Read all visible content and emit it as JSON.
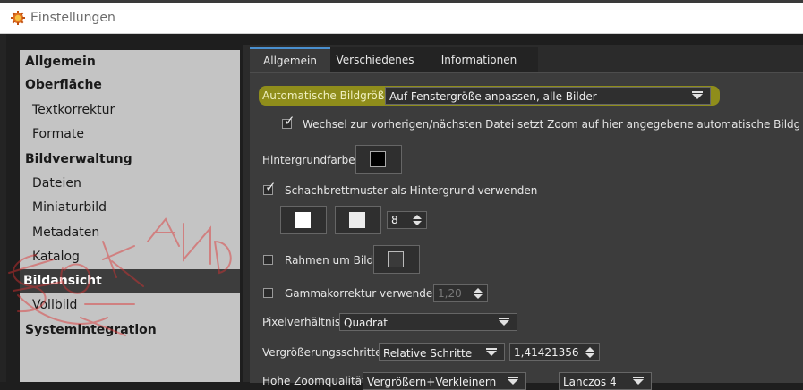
{
  "window": {
    "title": "Einstellungen",
    "app_icon": "gear-icon",
    "accent": "#e07020"
  },
  "sidebar": {
    "items": [
      {
        "label": "Allgemein",
        "bold": true
      },
      {
        "label": "Oberfläche",
        "bold": true
      },
      {
        "label": "Textkorrektur",
        "bold": false
      },
      {
        "label": "Formate",
        "bold": false
      },
      {
        "label": "Bildverwaltung",
        "bold": true
      },
      {
        "label": "Dateien",
        "bold": false
      },
      {
        "label": "Miniaturbild",
        "bold": false
      },
      {
        "label": "Metadaten",
        "bold": false
      },
      {
        "label": "Katalog",
        "bold": false
      },
      {
        "label": "Bildansicht",
        "bold": true,
        "selected": true
      },
      {
        "label": "Vollbild",
        "bold": false
      },
      {
        "label": "Systemintegration",
        "bold": true
      }
    ]
  },
  "tabs": [
    {
      "label": "Allgemein",
      "active": true
    },
    {
      "label": "Verschiedenes",
      "active": false
    },
    {
      "label": "Informationen",
      "active": false
    }
  ],
  "settings": {
    "auto_size_label": "Automatische Bildgröße",
    "auto_size_value": "Auf Fenstergröße anpassen, alle Bilder",
    "zoom_switch_label": "Wechsel zur vorherigen/nächsten Datei setzt Zoom auf hier angegebene automatische Bildgröße zurück",
    "zoom_switch_checked": true,
    "background_color_label": "Hintergrundfarbe",
    "background_color": "#000000",
    "checker_label": "Schachbrettmuster als Hintergrund verwenden",
    "checker_checked": true,
    "checker_size": "8",
    "border_label": "Rahmen um Bild",
    "border_checked": false,
    "gamma_label": "Gammakorrektur verwenden",
    "gamma_checked": false,
    "gamma_value": "1,20",
    "pixel_ratio_label": "Pixelverhältnis",
    "pixel_ratio_value": "Quadrat",
    "zoom_steps_label": "Vergrößerungsschritte",
    "zoom_steps_value": "Relative Schritte",
    "zoom_steps_factor": "1,41421356",
    "zoom_quality_label": "Hohe Zoomqualität",
    "zoom_quality_value": "Vergrößern+Verkleinern",
    "zoom_filter_value": "Lanczos 4"
  },
  "colors": {
    "highlight": "#d4d000",
    "selected_bg": "#3d3d3d",
    "tab_accent": "#4a90d0",
    "scribble": "#e03030"
  }
}
